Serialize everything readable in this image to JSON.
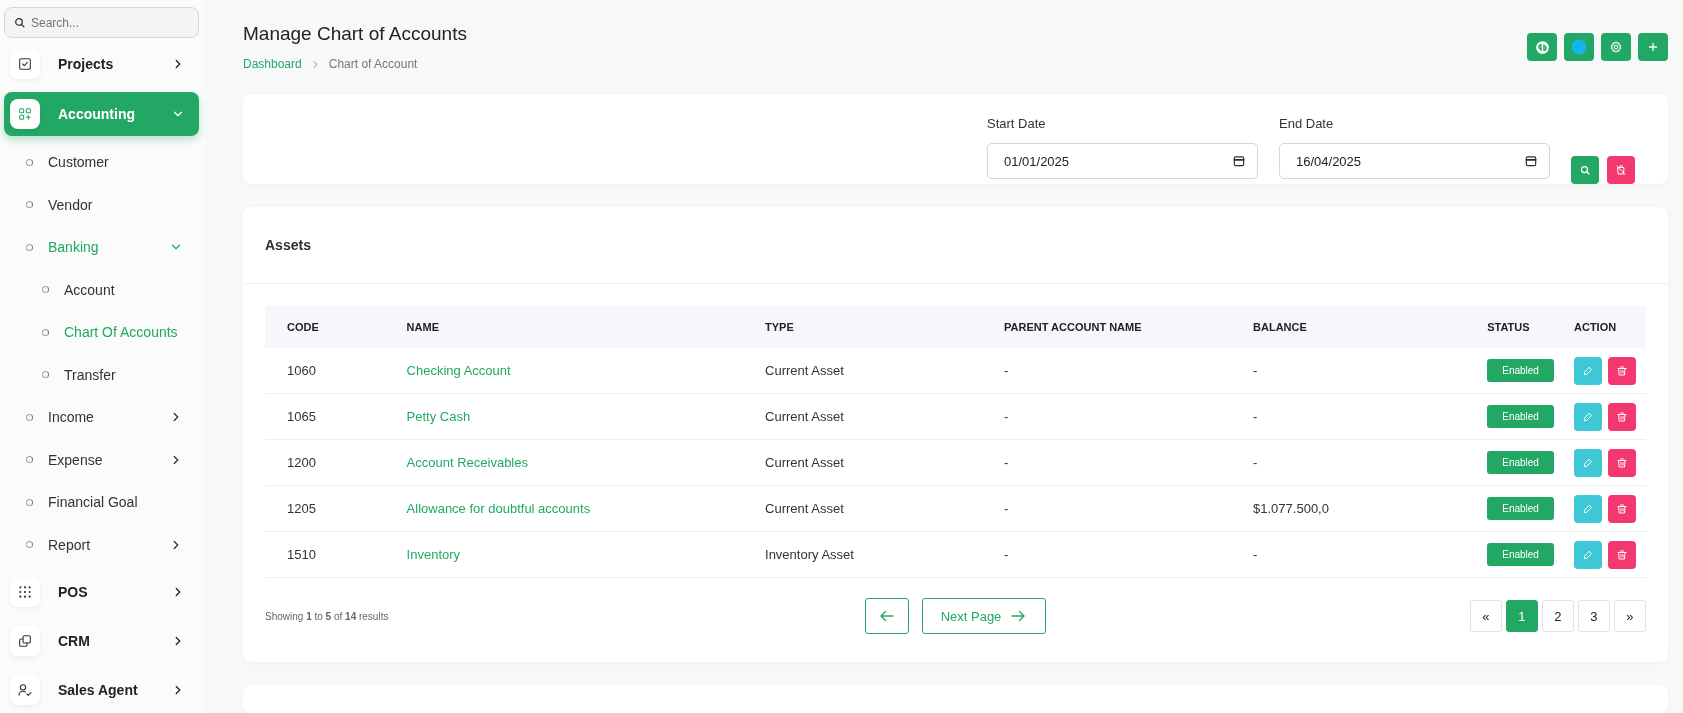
{
  "sidebar": {
    "search": {
      "placeholder": "Search..."
    },
    "items": [
      {
        "label": "Projects",
        "selected": false,
        "expandable": true,
        "expanded": false
      },
      {
        "label": "Accounting",
        "selected": true,
        "expandable": true,
        "expanded": true,
        "children": [
          {
            "label": "Customer",
            "selected": false,
            "expandable": false,
            "expanded": false
          },
          {
            "label": "Vendor",
            "selected": false,
            "expandable": false,
            "expanded": false
          },
          {
            "label": "Banking",
            "selected": true,
            "expandable": true,
            "expanded": true,
            "children": [
              {
                "label": "Account",
                "selected": false
              },
              {
                "label": "Chart Of Accounts",
                "selected": true
              },
              {
                "label": "Transfer",
                "selected": false
              }
            ]
          },
          {
            "label": "Income",
            "selected": false,
            "expandable": true,
            "expanded": false
          },
          {
            "label": "Expense",
            "selected": false,
            "expandable": true,
            "expanded": false
          },
          {
            "label": "Financial Goal",
            "selected": false,
            "expandable": false,
            "expanded": false
          },
          {
            "label": "Report",
            "selected": false,
            "expandable": true,
            "expanded": false
          }
        ]
      },
      {
        "label": "POS",
        "selected": false,
        "expandable": true,
        "expanded": false
      },
      {
        "label": "CRM",
        "selected": false,
        "expandable": true,
        "expanded": false
      },
      {
        "label": "Sales Agent",
        "selected": false,
        "expandable": true,
        "expanded": false
      }
    ]
  },
  "page": {
    "title": "Manage Chart of Accounts",
    "breadcrumb": [
      "Dashboard",
      "Chart of Account"
    ]
  },
  "filter": {
    "fields": [
      {
        "label": "Start Date",
        "value": "01/01/2025"
      },
      {
        "label": "End Date",
        "value": "16/04/2025"
      }
    ]
  },
  "table": {
    "title": "Assets",
    "columns": [
      "CODE",
      "NAME",
      "TYPE",
      "PARENT ACCOUNT NAME",
      "BALANCE",
      "STATUS",
      "ACTION"
    ],
    "rows": [
      {
        "code": "1060",
        "name": "Checking Account",
        "type": "Current Asset",
        "parent": "-",
        "balance": "-",
        "status": "Enabled"
      },
      {
        "code": "1065",
        "name": "Petty Cash",
        "type": "Current Asset",
        "parent": "-",
        "balance": "-",
        "status": "Enabled"
      },
      {
        "code": "1200",
        "name": "Account Receivables",
        "type": "Current Asset",
        "parent": "-",
        "balance": "-",
        "status": "Enabled"
      },
      {
        "code": "1205",
        "name": "Allowance for doubtful accounts",
        "type": "Current Asset",
        "parent": "-",
        "balance": "$1.077.500,0",
        "status": "Enabled"
      },
      {
        "code": "1510",
        "name": "Inventory",
        "type": "Inventory Asset",
        "parent": "-",
        "balance": "-",
        "status": "Enabled"
      }
    ],
    "summary": "Showing **1** to **5** of **14** results",
    "next_label": "Next Page",
    "pages": [
      {
        "label": "«",
        "selected": false
      },
      {
        "label": "1",
        "selected": true
      },
      {
        "label": "2",
        "selected": false
      },
      {
        "label": "3",
        "selected": false
      },
      {
        "label": "»",
        "selected": false
      }
    ]
  }
}
